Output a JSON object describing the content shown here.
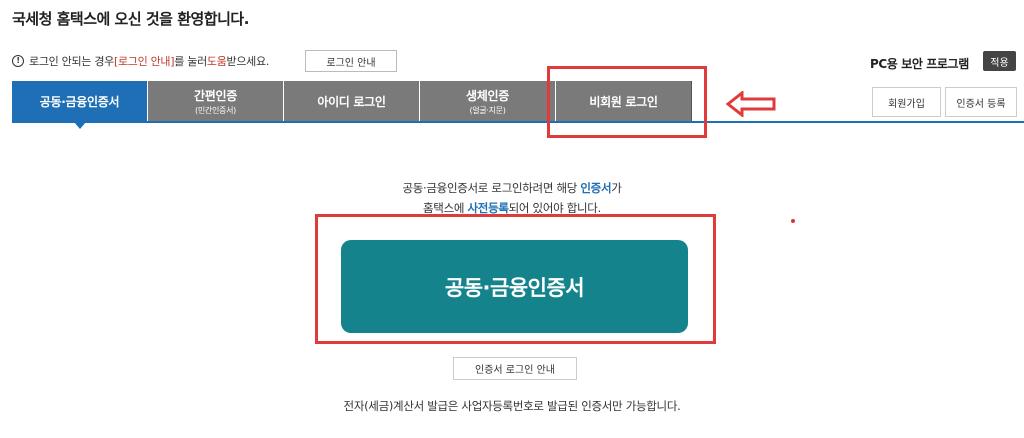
{
  "header": {
    "welcome": "국세청 홈택스에 오신 것을 환영합니다."
  },
  "notice": {
    "prefix": "로그인 안되는 경우 ",
    "link1": "[로그인 안내]",
    "middle": "를 눌러 ",
    "link2": "도움",
    "suffix": "받으세요.",
    "button_label": "로그인 안내"
  },
  "security": {
    "label": "PC용 보안 프로그램",
    "apply_label": "적용"
  },
  "tabs": [
    {
      "label": "공동·금융인증서",
      "sub": ""
    },
    {
      "label": "간편인증",
      "sub": "(민간인증서)"
    },
    {
      "label": "아이디 로그인",
      "sub": ""
    },
    {
      "label": "생체인증",
      "sub": "(얼굴·지문)"
    },
    {
      "label": "비회원 로그인",
      "sub": ""
    }
  ],
  "side_buttons": {
    "join": "회원가입",
    "cert_register": "인증서 등록"
  },
  "description": {
    "line1_prefix": "공동·금융인증서로 로그인하려면 해당 ",
    "line1_highlight": "인증서",
    "line1_suffix": "가",
    "line2_prefix": "홈택스에 ",
    "line2_highlight": "사전등록",
    "line2_suffix": "되어 있어야 합니다."
  },
  "main_button": {
    "label": "공동·금융인증서"
  },
  "guide_button": {
    "label": "인증서 로그인 안내"
  },
  "bottom_note": "전자(세금)계산서 발급은 사업자등록번호로 발급된 인증서만 가능합니다.",
  "colors": {
    "active_tab": "#1e6fb5",
    "inactive_tab": "#7a7a7a",
    "main_button": "#14838b",
    "highlight_box": "#e03b3b"
  }
}
